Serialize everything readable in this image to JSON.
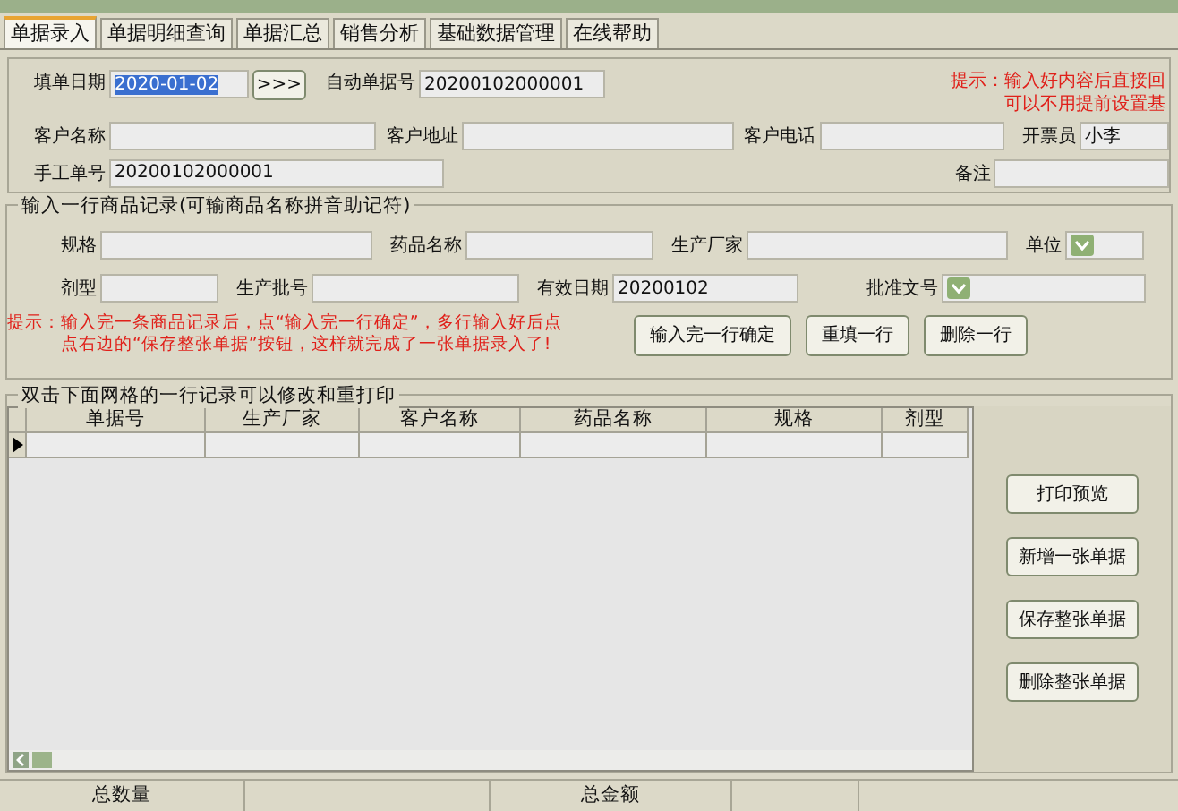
{
  "tabs": [
    {
      "label": "单据录入",
      "selected": true
    },
    {
      "label": "单据明细查询",
      "selected": false
    },
    {
      "label": "单据汇总",
      "selected": false
    },
    {
      "label": "销售分析",
      "selected": false
    },
    {
      "label": "基础数据管理",
      "selected": false
    },
    {
      "label": "在线帮助",
      "selected": false
    }
  ],
  "header": {
    "rows": [
      [
        {
          "label": "填单日期",
          "value": "2020-01-02",
          "kind": "date",
          "selected": true
        },
        {
          "label": "自动单据号",
          "value": "20200102000001",
          "kind": "text"
        }
      ],
      [
        {
          "label": "客户名称",
          "kind": "text"
        },
        {
          "label": "客户地址",
          "kind": "text"
        },
        {
          "label": "客户电话",
          "kind": "text"
        },
        {
          "label": "开票员",
          "value": "小李",
          "kind": "text"
        }
      ],
      [
        {
          "label": "手工单号",
          "value": "20200102000001",
          "kind": "text"
        },
        {
          "label": "备注",
          "kind": "text"
        }
      ]
    ],
    "date_button": ">>>",
    "hint": [
      "提示：输入好内容后直接回",
      "可以不用提前设置基"
    ]
  },
  "item_group": {
    "title": "输入一行商品记录(可输商品名称拼音助记符)",
    "rows": [
      [
        {
          "label": "规格",
          "kind": "text"
        },
        {
          "label": "药品名称",
          "kind": "text"
        },
        {
          "label": "生产厂家",
          "kind": "text"
        },
        {
          "label": "单位",
          "kind": "combo"
        }
      ],
      [
        {
          "label": "剂型",
          "kind": "text"
        },
        {
          "label": "生产批号",
          "kind": "text"
        },
        {
          "label": "有效日期",
          "value": "20200102",
          "kind": "text"
        },
        {
          "label": "批准文号",
          "kind": "combo"
        }
      ]
    ],
    "hint": [
      "提示：输入完一条商品记录后，点“输入完一行确定”，多行输入好后点",
      "点右边的“保存整张单据”按钮，这样就完成了一张单据录入了!"
    ],
    "buttons": [
      "输入完一行确定",
      "重填一行",
      "删除一行"
    ]
  },
  "grid_group": {
    "title": "双击下面网格的一行记录可以修改和重打印",
    "table": {
      "columns": [
        "单据号",
        "生产厂家",
        "客户名称",
        "药品名称",
        "规格",
        "剂型"
      ]
    },
    "buttons": [
      "打印预览",
      "新增一张单据",
      "保存整张单据",
      "删除整张单据"
    ]
  },
  "status_bar": [
    {
      "kind": "label",
      "text": "总数量"
    },
    {
      "kind": "blank"
    },
    {
      "kind": "label",
      "text": "总金额"
    },
    {
      "kind": "blank"
    }
  ]
}
